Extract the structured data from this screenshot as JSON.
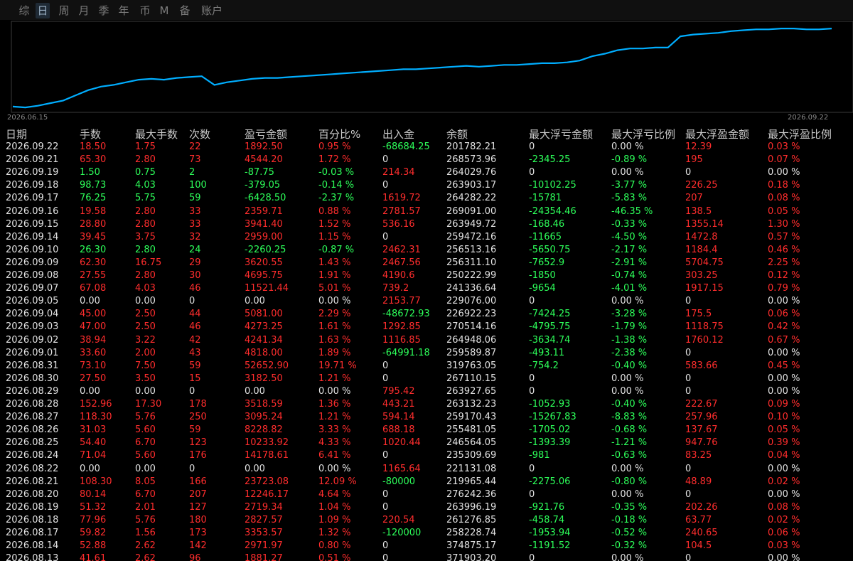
{
  "tabs": [
    "综",
    "日",
    "周",
    "月",
    "季",
    "年",
    "币",
    "M",
    "备",
    "账户"
  ],
  "active_tab": 1,
  "chart": {
    "start_label": "2026.06.15",
    "end_label": "2026.09.22",
    "line_color": "#00aeff"
  },
  "chart_data": {
    "type": "line",
    "x_range": [
      "2026.06.15",
      "2026.09.22"
    ],
    "note_values_relative": "equity curve shape, normalized 0-100",
    "values": [
      5,
      4,
      6,
      9,
      12,
      18,
      24,
      28,
      30,
      33,
      36,
      37,
      36,
      38,
      39,
      40,
      30,
      33,
      35,
      37,
      38,
      38,
      39,
      40,
      41,
      42,
      43,
      44,
      45,
      46,
      47,
      48,
      48,
      49,
      50,
      51,
      52,
      51,
      52,
      53,
      53,
      54,
      55,
      55,
      56,
      58,
      63,
      66,
      70,
      72,
      72,
      73,
      73,
      86,
      88,
      89,
      90,
      92,
      93,
      94,
      94,
      95,
      95,
      94,
      94,
      95
    ]
  },
  "headers": [
    "日期",
    "手数",
    "最大手数",
    "次数",
    "盈亏金额",
    "百分比%",
    "出入金",
    "余额",
    "最大浮亏金额",
    "最大浮亏比例",
    "最大浮盈金额",
    "最大浮盈比例"
  ],
  "rows": [
    {
      "date": "2026.09.22",
      "lots": "18.50",
      "max_lots": "1.75",
      "count": "22",
      "pnl": "1892.50",
      "pct": "0.95 %",
      "io": "-68684.25",
      "bal": "201782.21",
      "mfl": "0",
      "mflp": "0.00 %",
      "mfp": "12.39",
      "mfpp": "0.03 %",
      "c": [
        "w",
        "r",
        "r",
        "r",
        "r",
        "r",
        "g",
        "w",
        "w",
        "w",
        "r",
        "r"
      ]
    },
    {
      "date": "2026.09.21",
      "lots": "65.30",
      "max_lots": "2.80",
      "count": "73",
      "pnl": "4544.20",
      "pct": "1.72 %",
      "io": "0",
      "bal": "268573.96",
      "mfl": "-2345.25",
      "mflp": "-0.89 %",
      "mfp": "195",
      "mfpp": "0.07 %",
      "c": [
        "w",
        "r",
        "r",
        "r",
        "r",
        "r",
        "w",
        "w",
        "g",
        "g",
        "r",
        "r"
      ]
    },
    {
      "date": "2026.09.19",
      "lots": "1.50",
      "max_lots": "0.75",
      "count": "2",
      "pnl": "-87.75",
      "pct": "-0.03 %",
      "io": "214.34",
      "bal": "264029.76",
      "mfl": "0",
      "mflp": "0.00 %",
      "mfp": "0",
      "mfpp": "0.00 %",
      "c": [
        "w",
        "g",
        "g",
        "g",
        "g",
        "g",
        "r",
        "w",
        "w",
        "w",
        "w",
        "w"
      ]
    },
    {
      "date": "2026.09.18",
      "lots": "98.73",
      "max_lots": "4.03",
      "count": "100",
      "pnl": "-379.05",
      "pct": "-0.14 %",
      "io": "0",
      "bal": "263903.17",
      "mfl": "-10102.25",
      "mflp": "-3.77 %",
      "mfp": "226.25",
      "mfpp": "0.18 %",
      "c": [
        "w",
        "g",
        "g",
        "g",
        "g",
        "g",
        "w",
        "w",
        "g",
        "g",
        "r",
        "r"
      ]
    },
    {
      "date": "2026.09.17",
      "lots": "76.25",
      "max_lots": "5.75",
      "count": "59",
      "pnl": "-6428.50",
      "pct": "-2.37 %",
      "io": "1619.72",
      "bal": "264282.22",
      "mfl": "-15781",
      "mflp": "-5.83 %",
      "mfp": "207",
      "mfpp": "0.08 %",
      "c": [
        "w",
        "g",
        "g",
        "g",
        "g",
        "g",
        "r",
        "w",
        "g",
        "g",
        "r",
        "r"
      ]
    },
    {
      "date": "2026.09.16",
      "lots": "19.58",
      "max_lots": "2.80",
      "count": "33",
      "pnl": "2359.71",
      "pct": "0.88 %",
      "io": "2781.57",
      "bal": "269091.00",
      "mfl": "-24354.46",
      "mflp": "-46.35 %",
      "mfp": "138.5",
      "mfpp": "0.05 %",
      "c": [
        "w",
        "r",
        "r",
        "r",
        "r",
        "r",
        "r",
        "w",
        "g",
        "g",
        "r",
        "r"
      ]
    },
    {
      "date": "2026.09.15",
      "lots": "28.80",
      "max_lots": "2.80",
      "count": "33",
      "pnl": "3941.40",
      "pct": "1.52 %",
      "io": "536.16",
      "bal": "263949.72",
      "mfl": "-168.46",
      "mflp": "-0.33 %",
      "mfp": "1355.14",
      "mfpp": "1.30 %",
      "c": [
        "w",
        "r",
        "r",
        "r",
        "r",
        "r",
        "r",
        "w",
        "g",
        "g",
        "r",
        "r"
      ]
    },
    {
      "date": "2026.09.14",
      "lots": "39.45",
      "max_lots": "3.75",
      "count": "32",
      "pnl": "2959.00",
      "pct": "1.15 %",
      "io": "0",
      "bal": "259472.16",
      "mfl": "-11665",
      "mflp": "-4.50 %",
      "mfp": "1472.8",
      "mfpp": "0.57 %",
      "c": [
        "w",
        "r",
        "r",
        "r",
        "r",
        "r",
        "w",
        "w",
        "g",
        "g",
        "r",
        "r"
      ]
    },
    {
      "date": "2026.09.10",
      "lots": "26.30",
      "max_lots": "2.80",
      "count": "24",
      "pnl": "-2260.25",
      "pct": "-0.87 %",
      "io": "2462.31",
      "bal": "256513.16",
      "mfl": "-5650.75",
      "mflp": "-2.17 %",
      "mfp": "1184.4",
      "mfpp": "0.46 %",
      "c": [
        "w",
        "g",
        "g",
        "g",
        "g",
        "g",
        "r",
        "w",
        "g",
        "g",
        "r",
        "r"
      ]
    },
    {
      "date": "2026.09.09",
      "lots": "62.30",
      "max_lots": "16.75",
      "count": "29",
      "pnl": "3620.55",
      "pct": "1.43 %",
      "io": "2467.56",
      "bal": "256311.10",
      "mfl": "-7652.9",
      "mflp": "-2.91 %",
      "mfp": "5704.75",
      "mfpp": "2.25 %",
      "c": [
        "w",
        "r",
        "r",
        "r",
        "r",
        "r",
        "r",
        "w",
        "g",
        "g",
        "r",
        "r"
      ]
    },
    {
      "date": "2026.09.08",
      "lots": "27.55",
      "max_lots": "2.80",
      "count": "30",
      "pnl": "4695.75",
      "pct": "1.91 %",
      "io": "4190.6",
      "bal": "250222.99",
      "mfl": "-1850",
      "mflp": "-0.74 %",
      "mfp": "303.25",
      "mfpp": "0.12 %",
      "c": [
        "w",
        "r",
        "r",
        "r",
        "r",
        "r",
        "r",
        "w",
        "g",
        "g",
        "r",
        "r"
      ]
    },
    {
      "date": "2026.09.07",
      "lots": "67.08",
      "max_lots": "4.03",
      "count": "46",
      "pnl": "11521.44",
      "pct": "5.01 %",
      "io": "739.2",
      "bal": "241336.64",
      "mfl": "-9654",
      "mflp": "-4.01 %",
      "mfp": "1917.15",
      "mfpp": "0.79 %",
      "c": [
        "w",
        "r",
        "r",
        "r",
        "r",
        "r",
        "r",
        "w",
        "g",
        "g",
        "r",
        "r"
      ]
    },
    {
      "date": "2026.09.05",
      "lots": "0.00",
      "max_lots": "0.00",
      "count": "0",
      "pnl": "0.00",
      "pct": "0.00 %",
      "io": "2153.77",
      "bal": "229076.00",
      "mfl": "0",
      "mflp": "0.00 %",
      "mfp": "0",
      "mfpp": "0.00 %",
      "c": [
        "w",
        "w",
        "w",
        "w",
        "w",
        "w",
        "r",
        "w",
        "w",
        "w",
        "w",
        "w"
      ]
    },
    {
      "date": "2026.09.04",
      "lots": "45.00",
      "max_lots": "2.50",
      "count": "44",
      "pnl": "5081.00",
      "pct": "2.29 %",
      "io": "-48672.93",
      "bal": "226922.23",
      "mfl": "-7424.25",
      "mflp": "-3.28 %",
      "mfp": "175.5",
      "mfpp": "0.06 %",
      "c": [
        "w",
        "r",
        "r",
        "r",
        "r",
        "r",
        "g",
        "w",
        "g",
        "g",
        "r",
        "r"
      ]
    },
    {
      "date": "2026.09.03",
      "lots": "47.00",
      "max_lots": "2.50",
      "count": "46",
      "pnl": "4273.25",
      "pct": "1.61 %",
      "io": "1292.85",
      "bal": "270514.16",
      "mfl": "-4795.75",
      "mflp": "-1.79 %",
      "mfp": "1118.75",
      "mfpp": "0.42 %",
      "c": [
        "w",
        "r",
        "r",
        "r",
        "r",
        "r",
        "r",
        "w",
        "g",
        "g",
        "r",
        "r"
      ]
    },
    {
      "date": "2026.09.02",
      "lots": "38.94",
      "max_lots": "3.22",
      "count": "42",
      "pnl": "4241.34",
      "pct": "1.63 %",
      "io": "1116.85",
      "bal": "264948.06",
      "mfl": "-3634.74",
      "mflp": "-1.38 %",
      "mfp": "1760.12",
      "mfpp": "0.67 %",
      "c": [
        "w",
        "r",
        "r",
        "r",
        "r",
        "r",
        "r",
        "w",
        "g",
        "g",
        "r",
        "r"
      ]
    },
    {
      "date": "2026.09.01",
      "lots": "33.60",
      "max_lots": "2.00",
      "count": "43",
      "pnl": "4818.00",
      "pct": "1.89 %",
      "io": "-64991.18",
      "bal": "259589.87",
      "mfl": "-493.11",
      "mflp": "-2.38 %",
      "mfp": "0",
      "mfpp": "0.00 %",
      "c": [
        "w",
        "r",
        "r",
        "r",
        "r",
        "r",
        "g",
        "w",
        "g",
        "g",
        "w",
        "w"
      ]
    },
    {
      "date": "2026.08.31",
      "lots": "73.10",
      "max_lots": "7.50",
      "count": "59",
      "pnl": "52652.90",
      "pct": "19.71 %",
      "io": "0",
      "bal": "319763.05",
      "mfl": "-754.2",
      "mflp": "-0.40 %",
      "mfp": "583.66",
      "mfpp": "0.45 %",
      "c": [
        "w",
        "r",
        "r",
        "r",
        "r",
        "r",
        "w",
        "w",
        "g",
        "g",
        "r",
        "r"
      ]
    },
    {
      "date": "2026.08.30",
      "lots": "27.50",
      "max_lots": "3.50",
      "count": "15",
      "pnl": "3182.50",
      "pct": "1.21 %",
      "io": "0",
      "bal": "267110.15",
      "mfl": "0",
      "mflp": "0.00 %",
      "mfp": "0",
      "mfpp": "0.00 %",
      "c": [
        "w",
        "r",
        "r",
        "r",
        "r",
        "r",
        "w",
        "w",
        "w",
        "w",
        "w",
        "w"
      ]
    },
    {
      "date": "2026.08.29",
      "lots": "0.00",
      "max_lots": "0.00",
      "count": "0",
      "pnl": "0.00",
      "pct": "0.00 %",
      "io": "795.42",
      "bal": "263927.65",
      "mfl": "0",
      "mflp": "0.00 %",
      "mfp": "0",
      "mfpp": "0.00 %",
      "c": [
        "w",
        "w",
        "w",
        "w",
        "w",
        "w",
        "r",
        "w",
        "w",
        "w",
        "w",
        "w"
      ]
    },
    {
      "date": "2026.08.28",
      "lots": "152.96",
      "max_lots": "17.30",
      "count": "178",
      "pnl": "3518.59",
      "pct": "1.36 %",
      "io": "443.21",
      "bal": "263132.23",
      "mfl": "-1052.93",
      "mflp": "-0.40 %",
      "mfp": "222.67",
      "mfpp": "0.09 %",
      "c": [
        "w",
        "r",
        "r",
        "r",
        "r",
        "r",
        "r",
        "w",
        "g",
        "g",
        "r",
        "r"
      ]
    },
    {
      "date": "2026.08.27",
      "lots": "118.30",
      "max_lots": "5.76",
      "count": "250",
      "pnl": "3095.24",
      "pct": "1.21 %",
      "io": "594.14",
      "bal": "259170.43",
      "mfl": "-15267.83",
      "mflp": "-8.83 %",
      "mfp": "257.96",
      "mfpp": "0.10 %",
      "c": [
        "w",
        "r",
        "r",
        "r",
        "r",
        "r",
        "r",
        "w",
        "g",
        "g",
        "r",
        "r"
      ]
    },
    {
      "date": "2026.08.26",
      "lots": "31.03",
      "max_lots": "5.60",
      "count": "59",
      "pnl": "8228.82",
      "pct": "3.33 %",
      "io": "688.18",
      "bal": "255481.05",
      "mfl": "-1705.02",
      "mflp": "-0.68 %",
      "mfp": "137.67",
      "mfpp": "0.05 %",
      "c": [
        "w",
        "r",
        "r",
        "r",
        "r",
        "r",
        "r",
        "w",
        "g",
        "g",
        "r",
        "r"
      ]
    },
    {
      "date": "2026.08.25",
      "lots": "54.40",
      "max_lots": "6.70",
      "count": "123",
      "pnl": "10233.92",
      "pct": "4.33 %",
      "io": "1020.44",
      "bal": "246564.05",
      "mfl": "-1393.39",
      "mflp": "-1.21 %",
      "mfp": "947.76",
      "mfpp": "0.39 %",
      "c": [
        "w",
        "r",
        "r",
        "r",
        "r",
        "r",
        "r",
        "w",
        "g",
        "g",
        "r",
        "r"
      ]
    },
    {
      "date": "2026.08.24",
      "lots": "71.04",
      "max_lots": "5.60",
      "count": "176",
      "pnl": "14178.61",
      "pct": "6.41 %",
      "io": "0",
      "bal": "235309.69",
      "mfl": "-981",
      "mflp": "-0.63 %",
      "mfp": "83.25",
      "mfpp": "0.04 %",
      "c": [
        "w",
        "r",
        "r",
        "r",
        "r",
        "r",
        "w",
        "w",
        "g",
        "g",
        "r",
        "r"
      ]
    },
    {
      "date": "2026.08.22",
      "lots": "0.00",
      "max_lots": "0.00",
      "count": "0",
      "pnl": "0.00",
      "pct": "0.00 %",
      "io": "1165.64",
      "bal": "221131.08",
      "mfl": "0",
      "mflp": "0.00 %",
      "mfp": "0",
      "mfpp": "0.00 %",
      "c": [
        "w",
        "w",
        "w",
        "w",
        "w",
        "w",
        "r",
        "w",
        "w",
        "w",
        "w",
        "w"
      ]
    },
    {
      "date": "2026.08.21",
      "lots": "108.30",
      "max_lots": "8.05",
      "count": "166",
      "pnl": "23723.08",
      "pct": "12.09 %",
      "io": "-80000",
      "bal": "219965.44",
      "mfl": "-2275.06",
      "mflp": "-0.80 %",
      "mfp": "48.89",
      "mfpp": "0.02 %",
      "c": [
        "w",
        "r",
        "r",
        "r",
        "r",
        "r",
        "g",
        "w",
        "g",
        "g",
        "r",
        "r"
      ]
    },
    {
      "date": "2026.08.20",
      "lots": "80.14",
      "max_lots": "6.70",
      "count": "207",
      "pnl": "12246.17",
      "pct": "4.64 %",
      "io": "0",
      "bal": "276242.36",
      "mfl": "0",
      "mflp": "0.00 %",
      "mfp": "0",
      "mfpp": "0.00 %",
      "c": [
        "w",
        "r",
        "r",
        "r",
        "r",
        "r",
        "w",
        "w",
        "w",
        "w",
        "w",
        "w"
      ]
    },
    {
      "date": "2026.08.19",
      "lots": "51.32",
      "max_lots": "2.01",
      "count": "127",
      "pnl": "2719.34",
      "pct": "1.04 %",
      "io": "0",
      "bal": "263996.19",
      "mfl": "-921.76",
      "mflp": "-0.35 %",
      "mfp": "202.26",
      "mfpp": "0.08 %",
      "c": [
        "w",
        "r",
        "r",
        "r",
        "r",
        "r",
        "w",
        "w",
        "g",
        "g",
        "r",
        "r"
      ]
    },
    {
      "date": "2026.08.18",
      "lots": "77.96",
      "max_lots": "5.76",
      "count": "180",
      "pnl": "2827.57",
      "pct": "1.09 %",
      "io": "220.54",
      "bal": "261276.85",
      "mfl": "-458.74",
      "mflp": "-0.18 %",
      "mfp": "63.77",
      "mfpp": "0.02 %",
      "c": [
        "w",
        "r",
        "r",
        "r",
        "r",
        "r",
        "r",
        "w",
        "g",
        "g",
        "r",
        "r"
      ]
    },
    {
      "date": "2026.08.17",
      "lots": "59.82",
      "max_lots": "1.56",
      "count": "173",
      "pnl": "3353.57",
      "pct": "1.32 %",
      "io": "-120000",
      "bal": "258228.74",
      "mfl": "-1953.94",
      "mflp": "-0.52 %",
      "mfp": "240.65",
      "mfpp": "0.06 %",
      "c": [
        "w",
        "r",
        "r",
        "r",
        "r",
        "r",
        "g",
        "w",
        "g",
        "g",
        "r",
        "r"
      ]
    },
    {
      "date": "2026.08.14",
      "lots": "52.88",
      "max_lots": "2.62",
      "count": "142",
      "pnl": "2971.97",
      "pct": "0.80 %",
      "io": "0",
      "bal": "374875.17",
      "mfl": "-1191.52",
      "mflp": "-0.32 %",
      "mfp": "104.5",
      "mfpp": "0.03 %",
      "c": [
        "w",
        "r",
        "r",
        "r",
        "r",
        "r",
        "w",
        "w",
        "g",
        "g",
        "r",
        "r"
      ]
    },
    {
      "date": "2026.08.13",
      "lots": "41.61",
      "max_lots": "2.62",
      "count": "96",
      "pnl": "1881.27",
      "pct": "0.51 %",
      "io": "0",
      "bal": "371903.20",
      "mfl": "0",
      "mflp": "0.00 %",
      "mfp": "0",
      "mfpp": "0.00 %",
      "c": [
        "w",
        "r",
        "r",
        "r",
        "r",
        "r",
        "w",
        "w",
        "w",
        "w",
        "w",
        "w"
      ]
    }
  ]
}
